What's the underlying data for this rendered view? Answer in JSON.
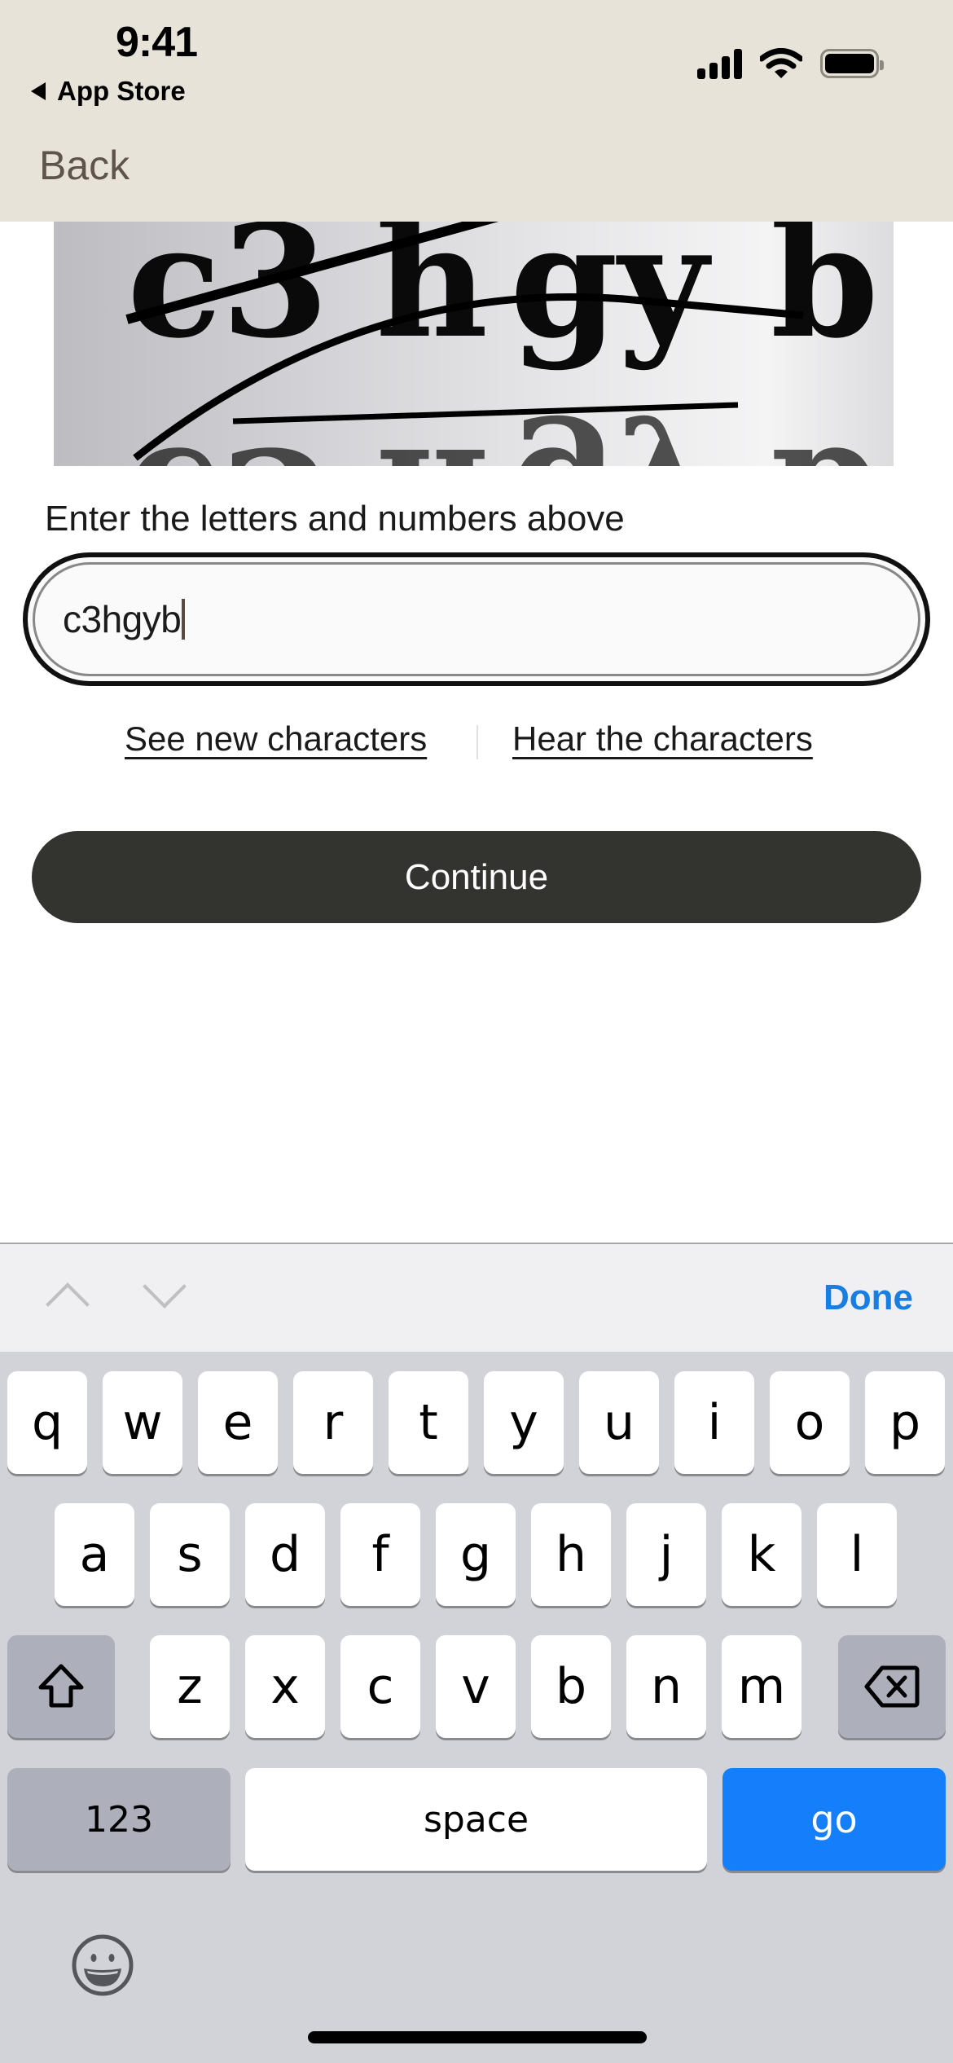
{
  "status_bar": {
    "time": "9:41",
    "back_app": "App Store",
    "icons": [
      "cellular-signal-icon",
      "wifi-icon",
      "battery-icon"
    ]
  },
  "nav": {
    "back_label": "Back"
  },
  "captcha": {
    "image_text": "c3hgyb",
    "label": "Enter the letters and numbers above",
    "input_value": "c3hgyb",
    "see_new_label": "See new characters",
    "hear_label": "Hear the characters",
    "continue_label": "Continue"
  },
  "keyboard": {
    "accessory": {
      "prev_icon": "chevron-up-icon",
      "next_icon": "chevron-down-icon",
      "done_label": "Done"
    },
    "row1": [
      "q",
      "w",
      "e",
      "r",
      "t",
      "y",
      "u",
      "i",
      "o",
      "p"
    ],
    "row2": [
      "a",
      "s",
      "d",
      "f",
      "g",
      "h",
      "j",
      "k",
      "l"
    ],
    "row3": [
      "z",
      "x",
      "c",
      "v",
      "b",
      "n",
      "m"
    ],
    "shift_icon": "shift-icon",
    "backspace_icon": "backspace-icon",
    "numbers_label": "123",
    "space_label": "space",
    "go_label": "go",
    "emoji_icon": "emoji-icon"
  },
  "colors": {
    "header_bg": "#e7e3d8",
    "back_text": "#5e544b",
    "continue_bg": "#33342f",
    "accent_blue": "#147efb",
    "done_blue": "#1a7de0",
    "keyboard_bg": "#d2d3d8"
  }
}
